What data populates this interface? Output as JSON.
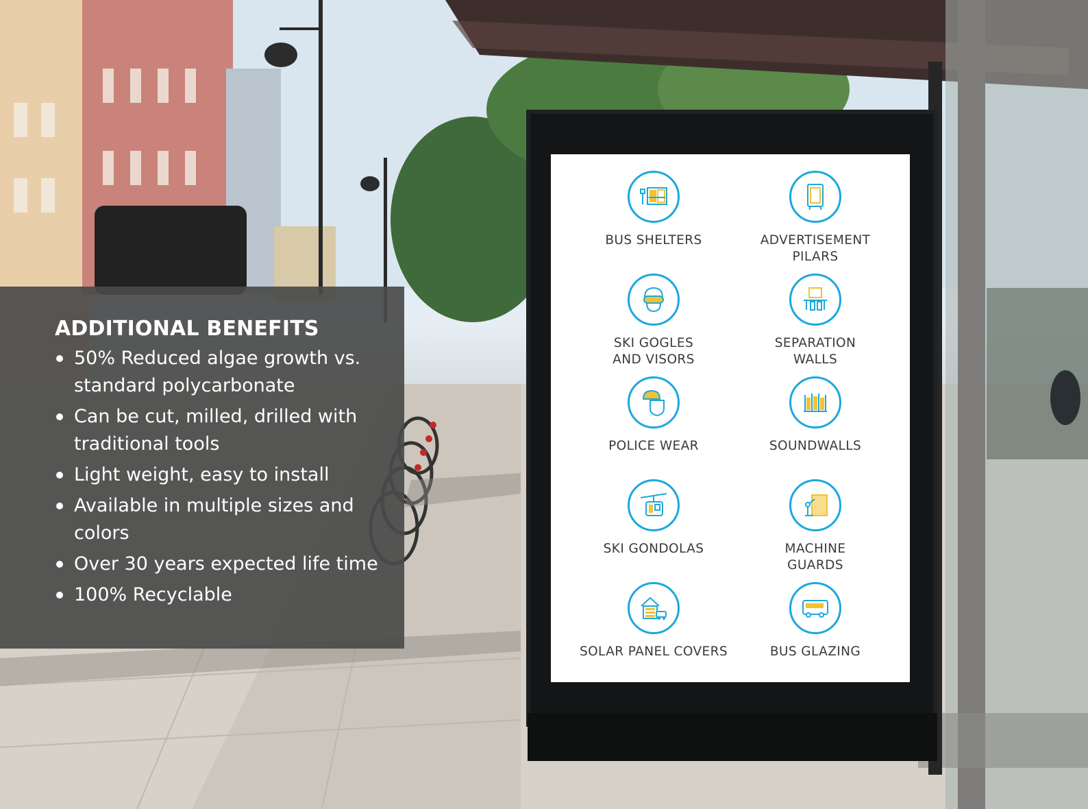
{
  "benefits": {
    "title": "ADDITIONAL BENEFITS",
    "items": [
      "50% Reduced algae growth vs. standard polycarbonate",
      "Can be cut, milled, drilled with traditional tools",
      "Light weight, easy to install",
      "Available in multiple sizes and colors",
      "Over 30 years expected life time",
      "100% Recyclable"
    ]
  },
  "poster": {
    "items": [
      {
        "label": "BUS SHELTERS",
        "icon": "bus-shelter-icon"
      },
      {
        "label": "ADVERTISEMENT\nPILARS",
        "icon": "advertisement-pillar-icon"
      },
      {
        "label": "SKI GOGLES\nAND VISORS",
        "icon": "ski-goggles-icon"
      },
      {
        "label": "SEPARATION\nWALLS",
        "icon": "separation-walls-icon"
      },
      {
        "label": "POLICE WEAR",
        "icon": "police-wear-icon"
      },
      {
        "label": "SOUNDWALLS",
        "icon": "soundwalls-icon"
      },
      {
        "label": "SKI GONDOLAS",
        "icon": "ski-gondola-icon"
      },
      {
        "label": "MACHINE\nGUARDS",
        "icon": "machine-guard-icon"
      },
      {
        "label": "SOLAR PANEL COVERS",
        "icon": "solar-panel-cover-icon"
      },
      {
        "label": "BUS GLAZING",
        "icon": "bus-glazing-icon"
      }
    ]
  },
  "colors": {
    "icon_blue": "#1ba8df",
    "icon_yellow": "#f2c230",
    "panel_gray": "#4a4a4a",
    "poster_text": "#3b3b3b"
  }
}
